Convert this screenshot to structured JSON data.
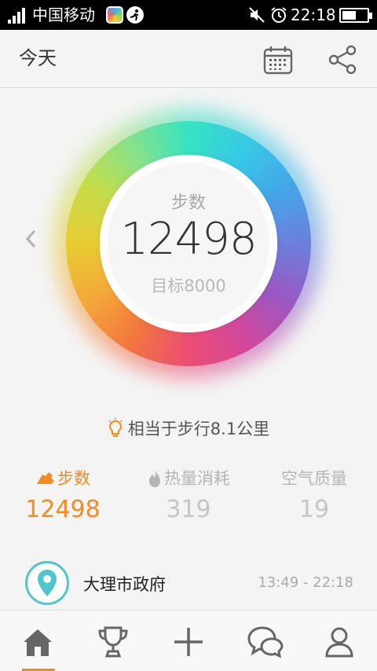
{
  "status_bar": {
    "carrier": "中国移动",
    "time": "22:18",
    "battery_level": 0.55
  },
  "header": {
    "title": "今天",
    "icons": [
      "calendar-icon",
      "share-icon"
    ]
  },
  "ring": {
    "label": "步数",
    "value": "12498",
    "goal": "目标8000",
    "progress": 1.0
  },
  "equivalent": {
    "text": "相当于步行8.1公里"
  },
  "stats": [
    {
      "icon": "shoe-icon",
      "label": "步数",
      "value": "12498",
      "color": "#f58a1f"
    },
    {
      "icon": "flame-icon",
      "label": "热量消耗",
      "value": "319",
      "color": "#b5b5b5"
    },
    {
      "icon": "",
      "label": "空气质量",
      "value": "19",
      "color": "#b5b5b5"
    }
  ],
  "location": {
    "name": "大理市政府",
    "time_range": "13:49 - 22:18"
  },
  "bottom_nav": {
    "items": [
      "home-icon",
      "trophy-icon",
      "plus-icon",
      "chat-icon",
      "profile-icon"
    ],
    "active_index": 0,
    "accent": "#f58a1f"
  }
}
